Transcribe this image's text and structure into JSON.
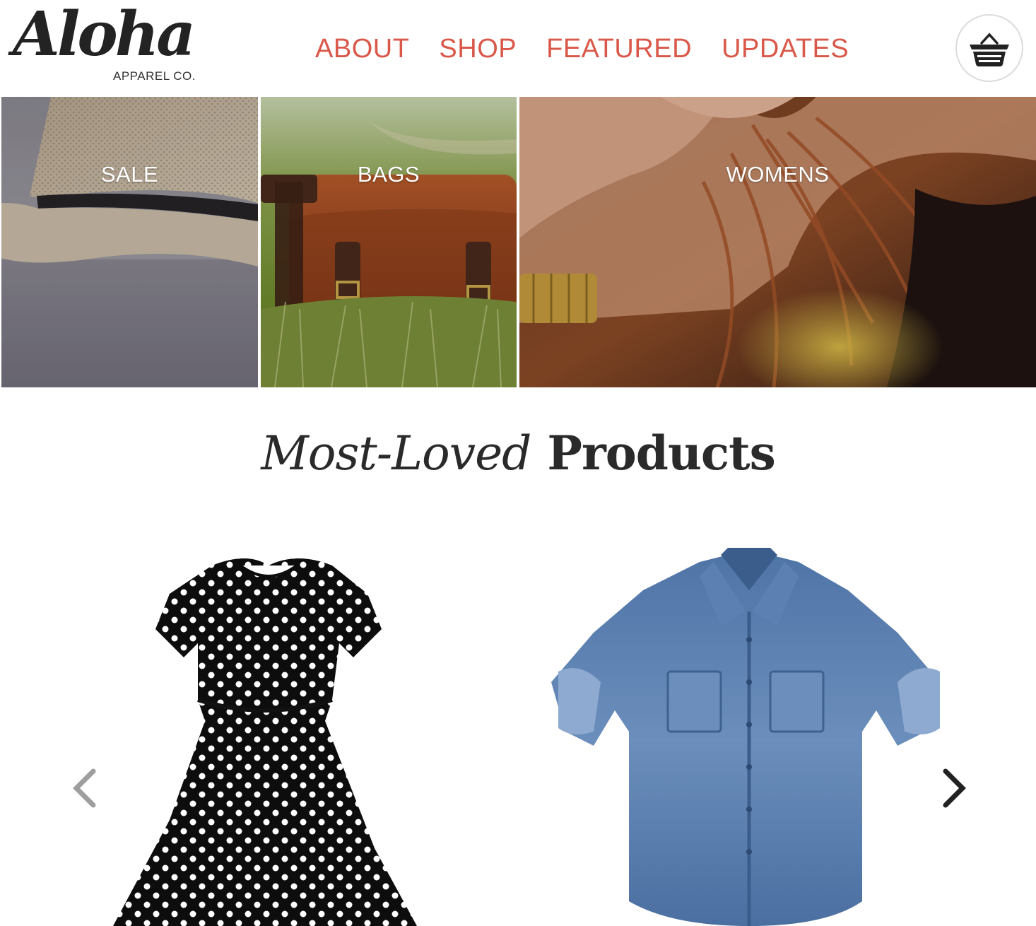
{
  "brand": {
    "name": "Aloha",
    "subtitle": "APPAREL CO."
  },
  "nav": {
    "items": [
      "ABOUT",
      "SHOP",
      "FEATURED",
      "UPDATES"
    ],
    "color": "#d9584a"
  },
  "cart": {
    "icon": "basket-icon"
  },
  "categories": [
    "SALE",
    "BAGS",
    "WOMENS"
  ],
  "section": {
    "title_italic": "Most-Loved",
    "title_bold": "Products"
  },
  "carousel": {
    "prev_icon": "chevron-left-icon",
    "next_icon": "chevron-right-icon"
  }
}
